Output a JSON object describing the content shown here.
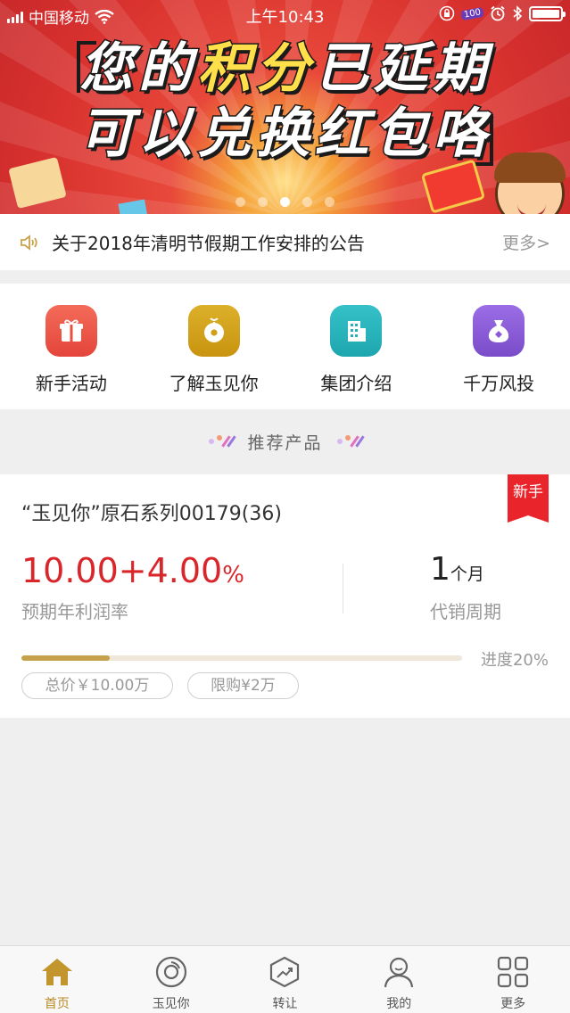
{
  "status_bar": {
    "carrier": "中国移动",
    "time": "上午10:43",
    "badge": "100"
  },
  "banner": {
    "line1_pre": "您的",
    "line1_highlight": "积分",
    "line1_post": "已延期",
    "line2": "可以兑换红包咯",
    "carousel_count": 5,
    "carousel_active_index": 2
  },
  "notice": {
    "text": "关于2018年清明节假期工作安排的公告",
    "more": "更多>"
  },
  "quick_menu": {
    "items": [
      {
        "label": "新手活动",
        "icon": "gift-icon",
        "color": "#ef5a4b"
      },
      {
        "label": "了解玉见你",
        "icon": "jade-pendant-icon",
        "color": "#d3a318"
      },
      {
        "label": "集团介绍",
        "icon": "building-icon",
        "color": "#27b0b8"
      },
      {
        "label": "千万风投",
        "icon": "money-bag-icon",
        "color": "#8a5bd6"
      }
    ]
  },
  "section": {
    "title": "推荐产品"
  },
  "product": {
    "name": "“玉见你”原石系列00179(36)",
    "tag": "新手",
    "rate_main": "10.00+4.00",
    "rate_unit": "%",
    "rate_label": "预期年利润率",
    "period_num": "1",
    "period_unit": "个月",
    "period_label": "代销周期",
    "progress": 0.2,
    "progress_text": "进度20%",
    "total_price": "总价￥10.00万",
    "limit": "限购¥2万"
  },
  "tabbar": {
    "tabs": [
      {
        "label": "首页",
        "icon": "home-icon",
        "active": true
      },
      {
        "label": "玉见你",
        "icon": "disc-icon",
        "active": false
      },
      {
        "label": "转让",
        "icon": "transfer-chart-icon",
        "active": false
      },
      {
        "label": "我的",
        "icon": "user-icon",
        "active": false
      },
      {
        "label": "更多",
        "icon": "grid-icon",
        "active": false
      }
    ]
  },
  "colors": {
    "accent_gold": "#b88a24",
    "rate_red": "#d8262b",
    "tag_red": "#e9242b",
    "progress_fill": "#c4a14a"
  }
}
